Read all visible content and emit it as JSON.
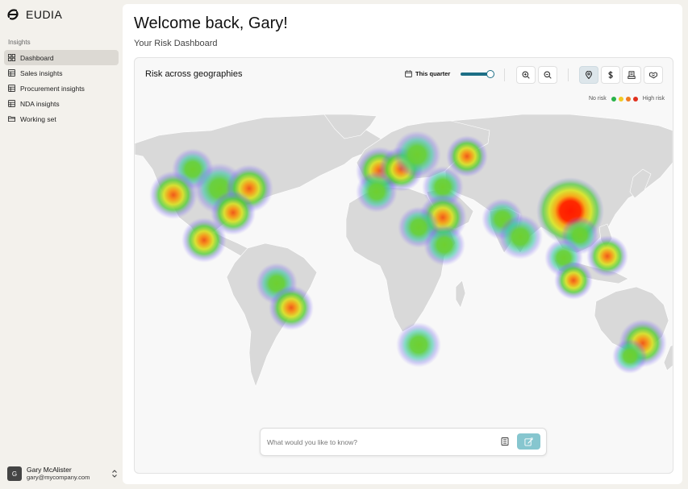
{
  "brand": {
    "name": "EUDIA",
    "logo_icon": "eudia-logo-icon"
  },
  "sidebar": {
    "section_label": "Insights",
    "items": [
      {
        "label": "Dashboard",
        "icon": "dashboard-icon",
        "active": true
      },
      {
        "label": "Sales insights",
        "icon": "table-icon",
        "active": false
      },
      {
        "label": "Procurement insights",
        "icon": "table-icon",
        "active": false
      },
      {
        "label": "NDA insights",
        "icon": "table-icon",
        "active": false
      },
      {
        "label": "Working set",
        "icon": "folder-icon",
        "active": false
      }
    ]
  },
  "user": {
    "initial": "G",
    "name": "Gary McAlister",
    "email": "gary@mycompany.com"
  },
  "header": {
    "greeting": "Welcome back, Gary!",
    "subtitle": "Your Risk Dashboard"
  },
  "card": {
    "title": "Risk across geographies",
    "period_label": "This quarter",
    "period_slider_value": 0.9,
    "tools": [
      "zoom-in-icon",
      "zoom-out-icon",
      "location-pin-icon",
      "dollar-icon",
      "building-icon",
      "handshake-icon"
    ],
    "active_tool": "location-pin-icon",
    "legend": {
      "low_label": "No risk",
      "high_label": "High risk",
      "colors": [
        "#2bb34a",
        "#f2c924",
        "#f07c23",
        "#e0301e"
      ]
    }
  },
  "ask": {
    "placeholder": "What would you like to know?"
  },
  "colors": {
    "accent": "#1d6f86",
    "send_button": "#86c6cf",
    "active_nav": "#dcd9d3"
  }
}
